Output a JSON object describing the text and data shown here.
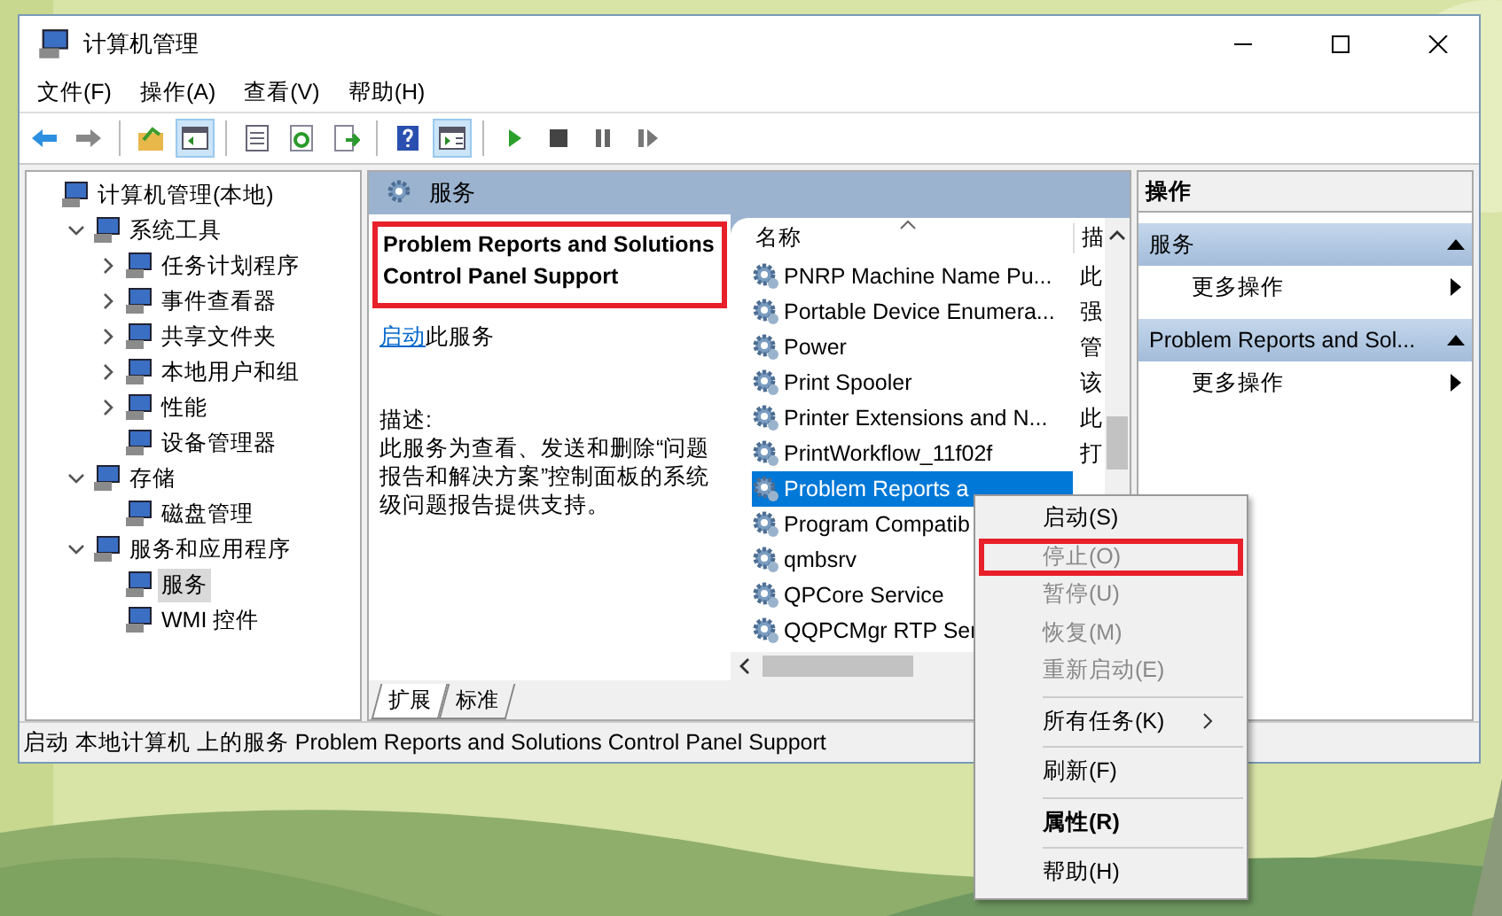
{
  "window": {
    "title": "计算机管理"
  },
  "menu_bar": [
    "文件(F)",
    "操作(A)",
    "查看(V)",
    "帮助(H)"
  ],
  "toolbar": {
    "buttons": [
      {
        "kind": "back",
        "pressed": false
      },
      {
        "kind": "forward",
        "pressed": false
      },
      {
        "kind": "sep"
      },
      {
        "kind": "up",
        "pressed": false
      },
      {
        "kind": "tree",
        "pressed": true
      },
      {
        "kind": "sep"
      },
      {
        "kind": "properties",
        "pressed": false
      },
      {
        "kind": "refresh",
        "pressed": false
      },
      {
        "kind": "export",
        "pressed": false
      },
      {
        "kind": "sep"
      },
      {
        "kind": "help",
        "pressed": false
      },
      {
        "kind": "pane",
        "pressed": true
      },
      {
        "kind": "sep"
      },
      {
        "kind": "play",
        "pressed": false
      },
      {
        "kind": "stop",
        "pressed": false
      },
      {
        "kind": "pause",
        "pressed": false
      },
      {
        "kind": "resume",
        "pressed": false
      }
    ]
  },
  "tree": [
    {
      "label": "计算机管理(本地)",
      "selected": false,
      "children": [
        {
          "label": "系统工具",
          "expanded": true,
          "selected": false,
          "children": [
            {
              "label": "任务计划程序",
              "expanded": false,
              "selected": false
            },
            {
              "label": "事件查看器",
              "expanded": false,
              "selected": false
            },
            {
              "label": "共享文件夹",
              "expanded": false,
              "selected": false
            },
            {
              "label": "本地用户和组",
              "expanded": false,
              "selected": false
            },
            {
              "label": "性能",
              "expanded": false,
              "selected": false
            },
            {
              "label": "设备管理器",
              "selected": false
            }
          ]
        },
        {
          "label": "存储",
          "expanded": true,
          "selected": false,
          "children": [
            {
              "label": "磁盘管理",
              "selected": false
            }
          ]
        },
        {
          "label": "服务和应用程序",
          "expanded": true,
          "selected": false,
          "children": [
            {
              "label": "服务",
              "selected": true
            },
            {
              "label": "WMI 控件",
              "selected": false
            }
          ]
        }
      ]
    }
  ],
  "center": {
    "header": "服务",
    "detail": {
      "title": "Problem Reports and Solutions Control Panel Support",
      "annotated": true,
      "link": "启动",
      "link_suffix": "此服务",
      "description_label": "描述:",
      "description": "此服务为查看、发送和删除“问题报告和解决方案”控制面板的系统级问题报告提供支持。"
    },
    "table": {
      "columns": [
        "名称",
        "描"
      ],
      "rows": [
        {
          "name": "PNRP Machine Name Pu...",
          "description": "此",
          "selected": false
        },
        {
          "name": "Portable Device Enumera...",
          "description": "强",
          "selected": false
        },
        {
          "name": "Power",
          "description": "管",
          "selected": false
        },
        {
          "name": "Print Spooler",
          "description": "该",
          "selected": false
        },
        {
          "name": "Printer Extensions and N...",
          "description": "此",
          "selected": false
        },
        {
          "name": "PrintWorkflow_11f02f",
          "description": "打",
          "selected": false
        },
        {
          "name": "Problem Reports a",
          "selected": true
        },
        {
          "name": "Program Compatib",
          "selected": false
        },
        {
          "name": "qmbsrv",
          "selected": false
        },
        {
          "name": "QPCore Service",
          "selected": false
        },
        {
          "name": "QQPCMgr RTP Ser",
          "selected": false
        }
      ]
    },
    "tabs": [
      {
        "label": "扩展",
        "selected": true
      },
      {
        "label": "标准",
        "selected": false
      }
    ]
  },
  "actions": {
    "title": "操作",
    "sections": [
      {
        "title": "服务",
        "items": [
          "更多操作"
        ]
      },
      {
        "title": "Problem Reports and Sol...",
        "items": [
          "更多操作"
        ]
      }
    ]
  },
  "status_bar": "启动 本地计算机 上的服务 Problem Reports and Solutions Control Panel Support",
  "context_menu": [
    {
      "kind": "item",
      "label": "启动(S)",
      "disabled": false
    },
    {
      "kind": "item",
      "label": "停止(O)",
      "disabled": true,
      "annotated": true
    },
    {
      "kind": "item",
      "label": "暂停(U)",
      "disabled": true
    },
    {
      "kind": "item",
      "label": "恢复(M)",
      "disabled": true
    },
    {
      "kind": "item",
      "label": "重新启动(E)",
      "disabled": true
    },
    {
      "kind": "separator"
    },
    {
      "kind": "submenu",
      "label": "所有任务(K)",
      "disabled": false
    },
    {
      "kind": "separator"
    },
    {
      "kind": "item",
      "label": "刷新(F)",
      "disabled": false
    },
    {
      "kind": "separator"
    },
    {
      "kind": "default",
      "label": "属性(R)",
      "disabled": false
    },
    {
      "kind": "separator"
    },
    {
      "kind": "item",
      "label": "帮助(H)",
      "disabled": false
    }
  ]
}
